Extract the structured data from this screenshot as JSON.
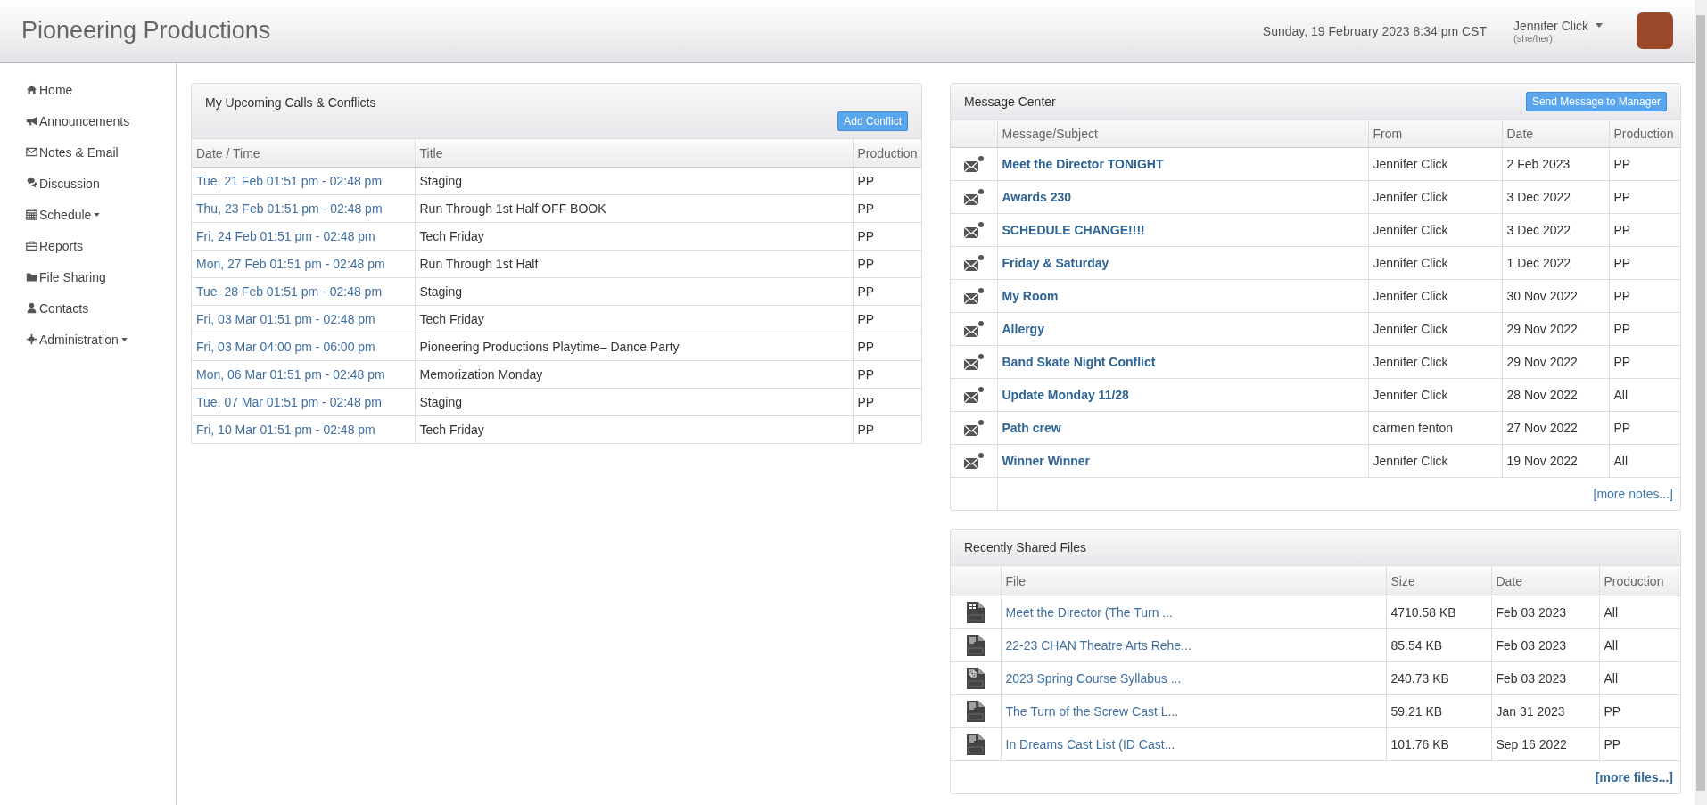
{
  "header": {
    "title": "Pioneering Productions",
    "datetime": "Sunday, 19 February 2023 8:34 pm CST",
    "user": {
      "name": "Jennifer Click",
      "pronouns": "(she/her)"
    }
  },
  "sidebar": {
    "items": [
      {
        "label": "Home",
        "kind": "link"
      },
      {
        "label": "Announcements",
        "kind": "link"
      },
      {
        "label": "Notes & Email",
        "kind": "link"
      },
      {
        "label": "Discussion",
        "kind": "link"
      },
      {
        "label": "Schedule",
        "kind": "dropdown"
      },
      {
        "label": "Reports",
        "kind": "link"
      },
      {
        "label": "File Sharing",
        "kind": "link"
      },
      {
        "label": "Contacts",
        "kind": "link"
      },
      {
        "label": "Administration",
        "kind": "dropdown"
      }
    ]
  },
  "calls": {
    "title": "My Upcoming Calls & Conflicts",
    "button": "Add Conflict",
    "columns": [
      "Date / Time",
      "Title",
      "Production"
    ],
    "rows": [
      [
        "Tue, 21 Feb 01:51 pm - 02:48 pm",
        "Staging",
        "PP"
      ],
      [
        "Thu, 23 Feb 01:51 pm - 02:48 pm",
        "Run Through 1st Half OFF BOOK",
        "PP"
      ],
      [
        "Fri, 24 Feb 01:51 pm - 02:48 pm",
        "Tech Friday",
        "PP"
      ],
      [
        "Mon, 27 Feb 01:51 pm - 02:48 pm",
        "Run Through 1st Half",
        "PP"
      ],
      [
        "Tue, 28 Feb 01:51 pm - 02:48 pm",
        "Staging",
        "PP"
      ],
      [
        "Fri, 03 Mar 01:51 pm - 02:48 pm",
        "Tech Friday",
        "PP"
      ],
      [
        "Fri, 03 Mar 04:00 pm - 06:00 pm",
        "Pioneering Productions Playtime– Dance Party",
        "PP"
      ],
      [
        "Mon, 06 Mar 01:51 pm - 02:48 pm",
        "Memorization Monday",
        "PP"
      ],
      [
        "Tue, 07 Mar 01:51 pm - 02:48 pm",
        "Staging",
        "PP"
      ],
      [
        "Fri, 10 Mar 01:51 pm - 02:48 pm",
        "Tech Friday",
        "PP"
      ]
    ]
  },
  "messages": {
    "title": "Message Center",
    "button": "Send Message to Manager",
    "columns": [
      "Message/Subject",
      "From",
      "Date",
      "Production"
    ],
    "rows": [
      [
        "Meet the Director TONIGHT",
        "Jennifer Click",
        "2 Feb 2023",
        "PP"
      ],
      [
        "Awards 230",
        "Jennifer Click",
        "3 Dec 2022",
        "PP"
      ],
      [
        "SCHEDULE CHANGE!!!!",
        "Jennifer Click",
        "3 Dec 2022",
        "PP"
      ],
      [
        "Friday & Saturday",
        "Jennifer Click",
        "1 Dec 2022",
        "PP"
      ],
      [
        "My Room",
        "Jennifer Click",
        "30 Nov 2022",
        "PP"
      ],
      [
        "Allergy",
        "Jennifer Click",
        "29 Nov 2022",
        "PP"
      ],
      [
        "Band Skate Night Conflict",
        "Jennifer Click",
        "29 Nov 2022",
        "PP"
      ],
      [
        "Update Monday 11/28",
        "Jennifer Click",
        "28 Nov 2022",
        "All"
      ],
      [
        "Path crew",
        "carmen fenton",
        "27 Nov 2022",
        "PP"
      ],
      [
        "Winner Winner",
        "Jennifer Click",
        "19 Nov 2022",
        "All"
      ]
    ],
    "more": "[more notes...]"
  },
  "files": {
    "title": "Recently Shared Files",
    "columns": [
      "File",
      "Size",
      "Date",
      "Production"
    ],
    "rows": [
      {
        "kind": "pptx",
        "name": "Meet the Director (The Turn ...",
        "size": "4710.58 KB",
        "date": "Feb 03 2023",
        "production": "All"
      },
      {
        "kind": "docx",
        "name": "22-23 CHAN Theatre Arts Rehe...",
        "size": "85.54 KB",
        "date": "Feb 03 2023",
        "production": "All"
      },
      {
        "kind": "pdf",
        "name": "2023 Spring Course Syllabus ...",
        "size": "240.73 KB",
        "date": "Feb 03 2023",
        "production": "All"
      },
      {
        "kind": "docx",
        "name": "The Turn of the Screw Cast L...",
        "size": "59.21 KB",
        "date": "Jan 31 2023",
        "production": "PP"
      },
      {
        "kind": "docx",
        "name": "In Dreams Cast List (ID Cast...",
        "size": "101.76 KB",
        "date": "Sep 16 2022",
        "production": "PP"
      }
    ],
    "more": "[more files...]"
  }
}
